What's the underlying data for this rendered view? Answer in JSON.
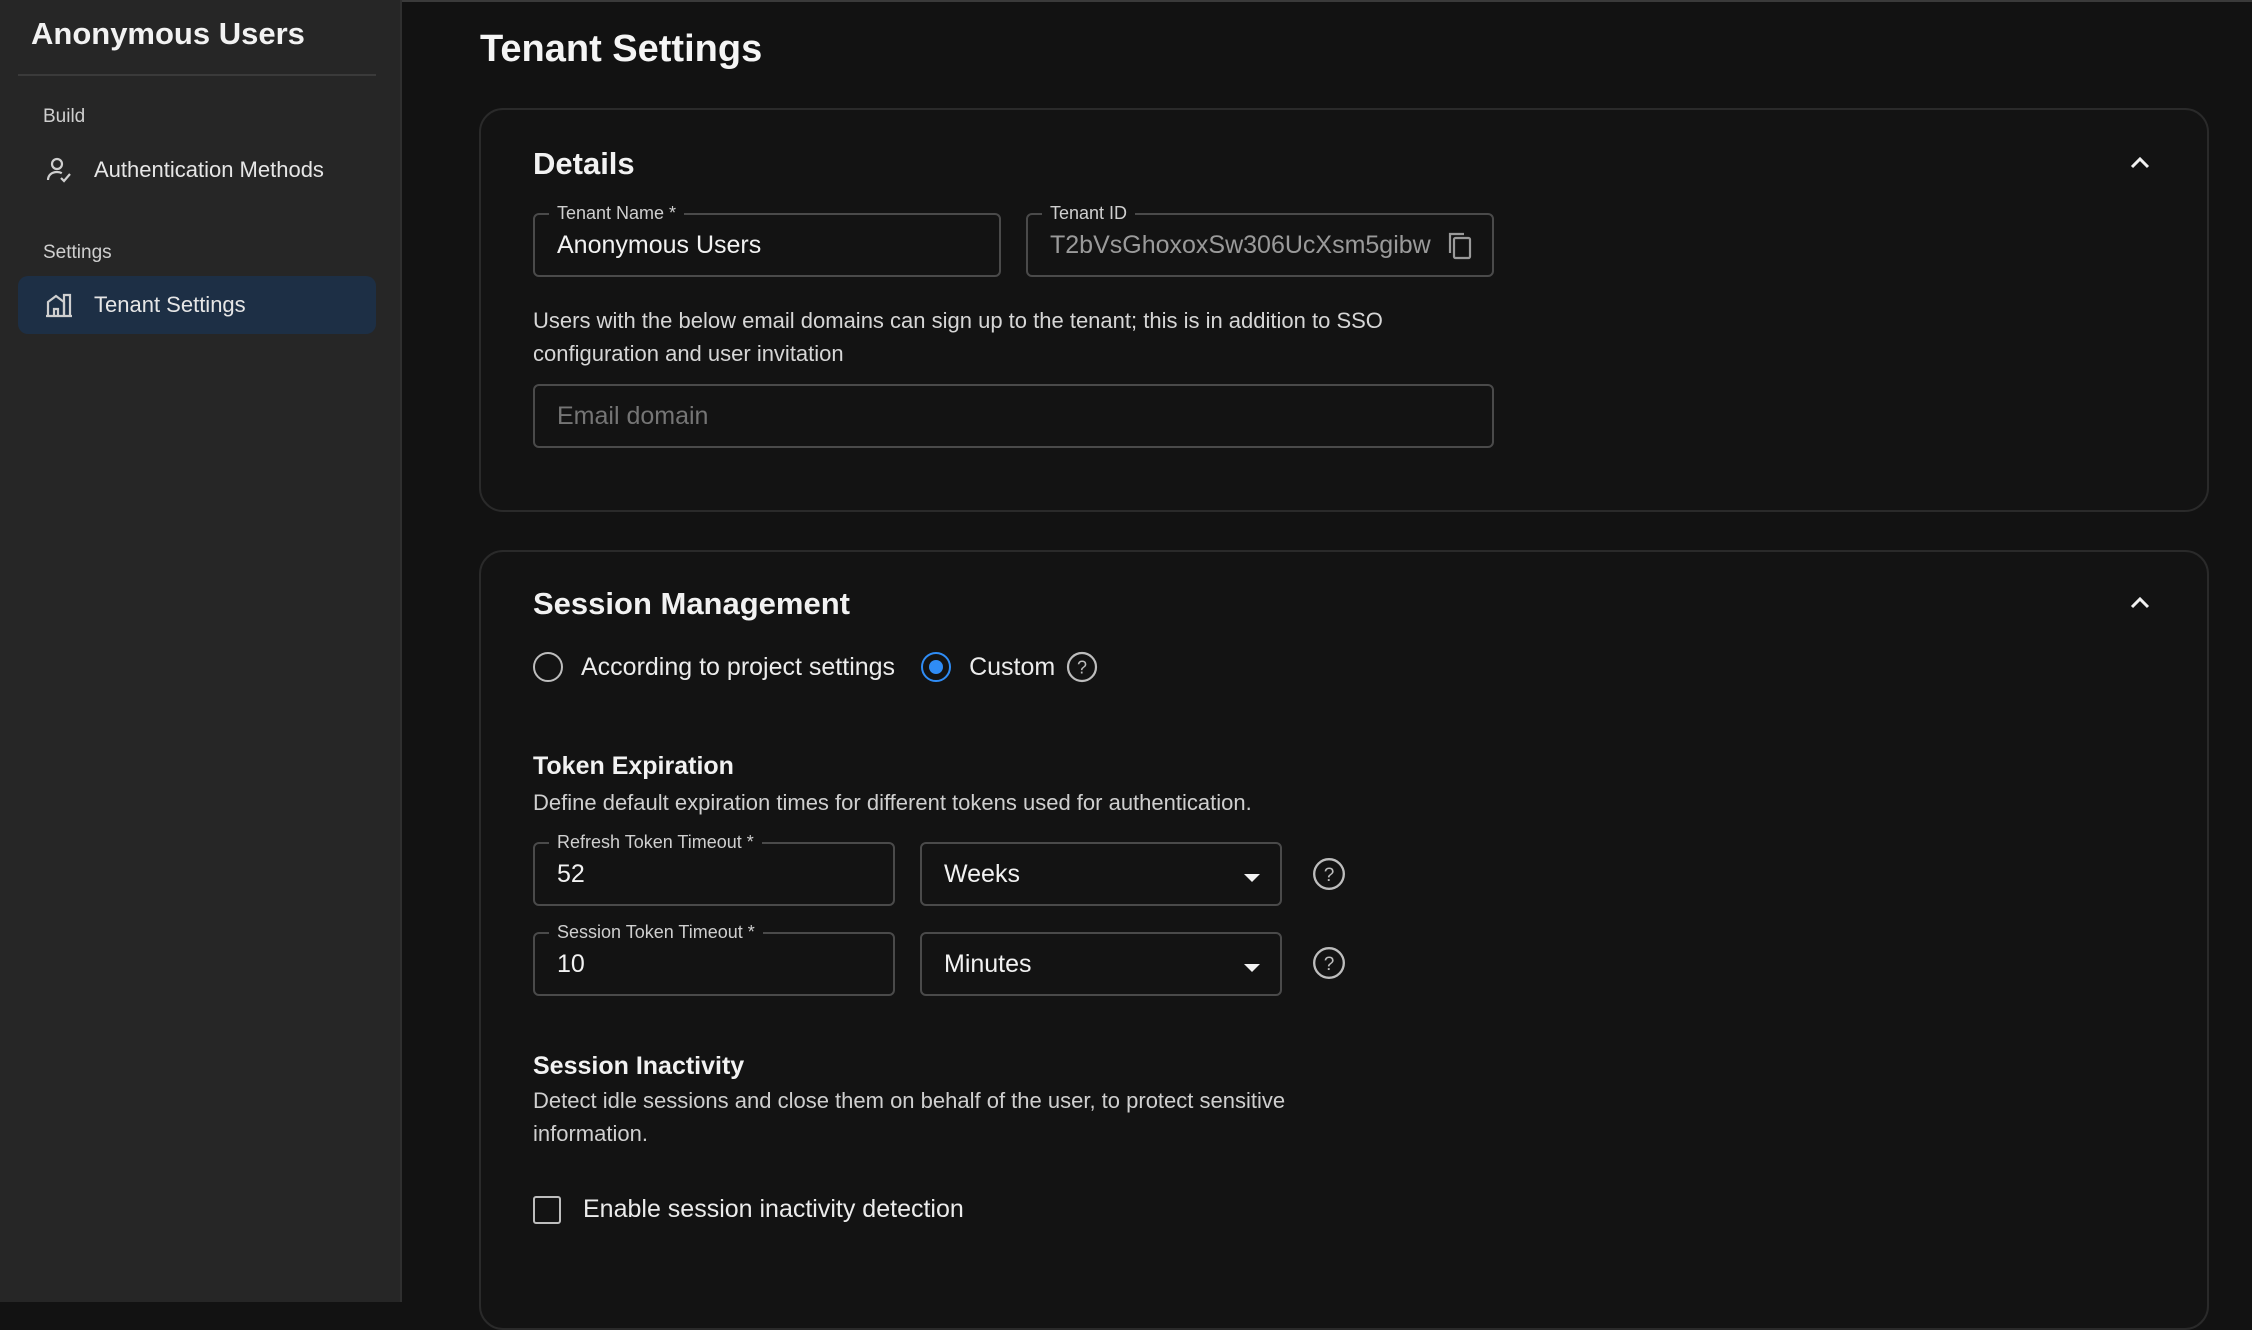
{
  "sidebar": {
    "title": "Anonymous Users",
    "sections": [
      {
        "label": "Build",
        "items": [
          {
            "label": "Authentication Methods",
            "icon": "user-check-icon"
          }
        ]
      },
      {
        "label": "Settings",
        "items": [
          {
            "label": "Tenant Settings",
            "icon": "building-icon",
            "active": true
          }
        ]
      }
    ]
  },
  "page": {
    "title": "Tenant Settings"
  },
  "details": {
    "title": "Details",
    "tenant_name": {
      "label": "Tenant Name *",
      "value": "Anonymous Users"
    },
    "tenant_id": {
      "label": "Tenant ID",
      "value": "T2bVsGhoxoxSw306UcXsm5gibw"
    },
    "domains_help": "Users with the below email domains can sign up to the tenant; this is in addition to SSO configuration and user invitation",
    "email_domain": {
      "placeholder": "Email domain",
      "value": ""
    }
  },
  "session": {
    "title": "Session Management",
    "options": [
      {
        "label": "According to project settings",
        "selected": false
      },
      {
        "label": "Custom",
        "selected": true
      }
    ],
    "token_expiration": {
      "title": "Token Expiration",
      "description": "Define default expiration times for different tokens used for authentication.",
      "refresh": {
        "label": "Refresh Token Timeout *",
        "value": "52",
        "unit": "Weeks"
      },
      "session": {
        "label": "Session Token Timeout *",
        "value": "10",
        "unit": "Minutes"
      }
    },
    "inactivity": {
      "title": "Session Inactivity",
      "description": "Detect idle sessions and close them on behalf of the user, to protect sensitive information.",
      "checkbox_label": "Enable session inactivity detection",
      "checked": false
    }
  },
  "colors": {
    "accent": "#2f8cf5",
    "sidebar_bg": "#262626",
    "active_item_bg": "#1d2f45",
    "page_bg": "#121212"
  }
}
